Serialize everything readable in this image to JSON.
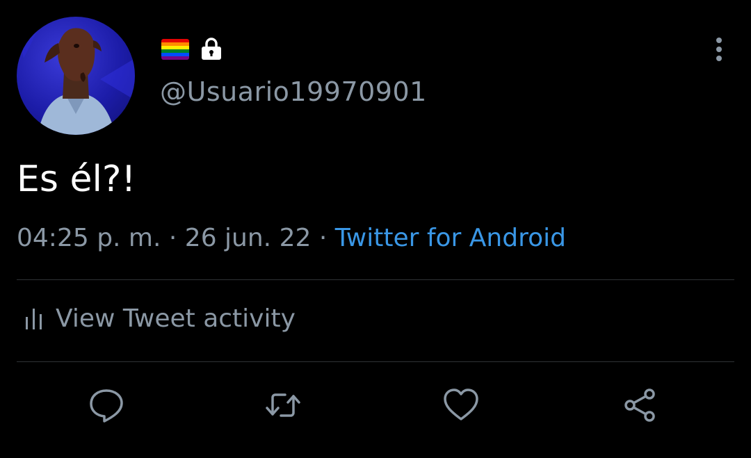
{
  "profile": {
    "handle": "@Usuario19970901",
    "badges": [
      "rainbow-flag-icon",
      "lock-icon"
    ]
  },
  "tweet": {
    "text": "Es él?!",
    "time": "04:25 p. m.",
    "separator": " · ",
    "date": "26 jun. 22",
    "source": "Twitter for Android"
  },
  "activity": {
    "label": "View Tweet activity"
  },
  "actions": [
    "reply-icon",
    "retweet-icon",
    "like-icon",
    "share-icon"
  ],
  "colors": {
    "background": "#000000",
    "text": "#ffffff",
    "secondary": "#8b98a5",
    "link": "#3a97e6",
    "divider": "#2f3336"
  }
}
